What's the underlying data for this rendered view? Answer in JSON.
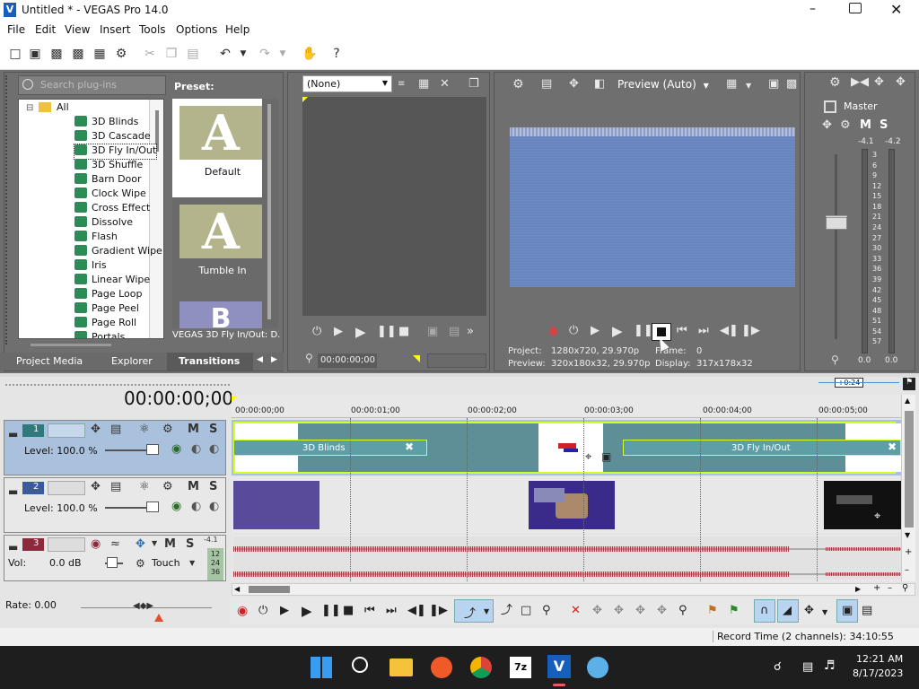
{
  "window": {
    "title": "Untitled * - VEGAS Pro 14.0"
  },
  "menu": [
    "File",
    "Edit",
    "View",
    "Insert",
    "Tools",
    "Options",
    "Help"
  ],
  "plugins": {
    "search_placeholder": "Search plug-ins",
    "root": "All",
    "items": [
      "3D Blinds",
      "3D Cascade",
      "3D Fly In/Out",
      "3D Shuffle",
      "Barn Door",
      "Clock Wipe",
      "Cross Effect",
      "Dissolve",
      "Flash",
      "Gradient Wipe",
      "Iris",
      "Linear Wipe",
      "Page Loop",
      "Page Peel",
      "Page Roll",
      "Portals"
    ],
    "selected": "3D Fly In/Out"
  },
  "presets": {
    "label": "Preset:",
    "items": [
      {
        "name": "Default",
        "glyph": "A"
      },
      {
        "name": "Tumble In",
        "glyph": "A"
      }
    ],
    "status": "VEGAS 3D Fly In/Out: D..."
  },
  "tabs": [
    "Project Media",
    "Explorer",
    "Transitions"
  ],
  "trimmer": {
    "dropdown": "(None)",
    "timecode": "00:00:00;00"
  },
  "preview": {
    "mode": "Preview (Auto)",
    "project_label": "Project:",
    "project_value": "1280x720, 29.970p",
    "preview_label": "Preview:",
    "preview_value": "320x180x32, 29.970p",
    "frame_label": "Frame:",
    "frame_value": "0",
    "display_label": "Display:",
    "display_value": "317x178x32"
  },
  "mixer": {
    "title": "Master",
    "peak_left": "-4.1",
    "peak_right": "-4.2",
    "scale": [
      "3",
      "6",
      "9",
      "12",
      "15",
      "18",
      "21",
      "24",
      "27",
      "30",
      "33",
      "36",
      "39",
      "42",
      "45",
      "48",
      "51",
      "54",
      "57"
    ],
    "bottom_left": "0.0",
    "bottom_right": "0.0"
  },
  "timeline": {
    "timecode": "00:00:00;00",
    "zoom": "+0:24",
    "ruler": [
      "00:00:00;00",
      "00:00:01;00",
      "00:00:02;00",
      "00:00:03;00",
      "00:00:04;00",
      "00:00:05;00"
    ],
    "tracks": [
      {
        "num": "1",
        "level": "Level: 100.0 %"
      },
      {
        "num": "2",
        "level": "Level: 100.0 %"
      },
      {
        "num": "3",
        "vol_label": "Vol:",
        "vol_value": "0.0 dB",
        "mode": "Touch",
        "meter_top": "-4.1",
        "meter_vals": [
          "12",
          "24",
          "36"
        ]
      }
    ],
    "clips": [
      {
        "label": "3D Blinds"
      },
      {
        "label": "3D Fly In/Out"
      }
    ],
    "rate": "Rate: 0.00"
  },
  "status": {
    "record_time": "Record Time (2 channels): 34:10:55"
  },
  "tray": {
    "time": "12:21 AM",
    "date": "8/17/2023"
  },
  "colors": {
    "track_blue": "#a9c1dc",
    "clip_teal": "#5e8e96",
    "audio_wave": "#9c3d48",
    "highlight": "#d4ff2a"
  }
}
